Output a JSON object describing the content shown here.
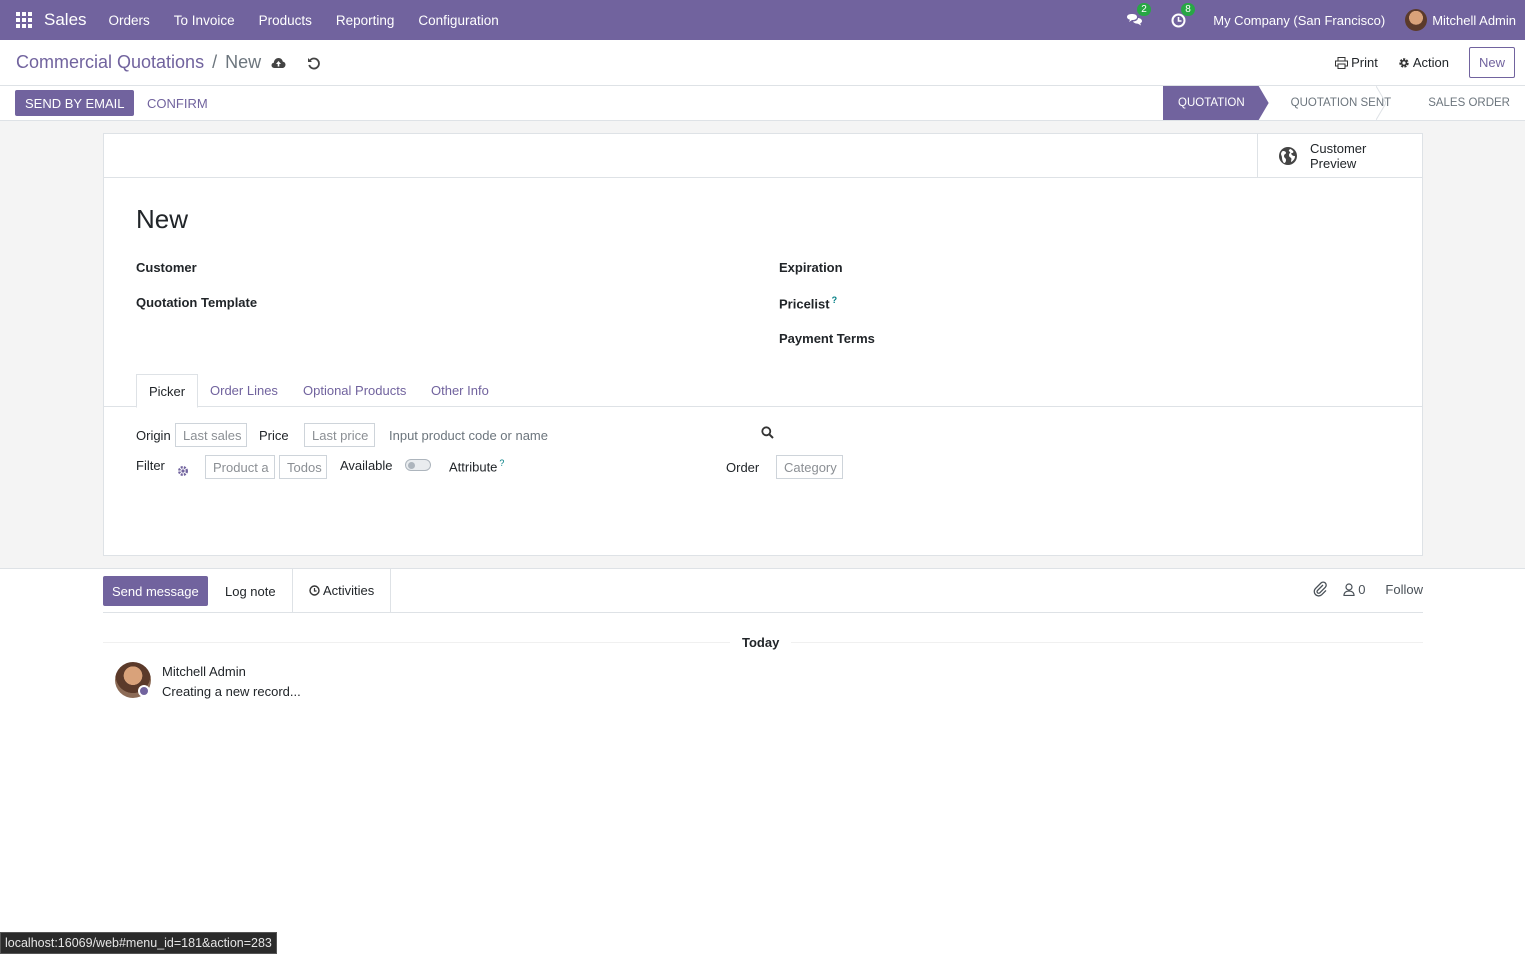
{
  "topbar": {
    "app_name": "Sales",
    "menu": [
      "Orders",
      "To Invoice",
      "Products",
      "Reporting",
      "Configuration"
    ],
    "messages_count": "2",
    "activities_count": "8",
    "company": "My Company (San Francisco)",
    "user": "Mitchell Admin",
    "colors": {
      "brand": "#71639e",
      "badge": "#28a745"
    }
  },
  "control": {
    "breadcrumb_parent": "Commercial Quotations",
    "breadcrumb_current": "New",
    "print_label": "Print",
    "action_label": "Action",
    "new_label": "New",
    "send_email_label": "SEND BY EMAIL",
    "confirm_label": "CONFIRM",
    "stages": [
      "QUOTATION",
      "QUOTATION SENT",
      "SALES ORDER"
    ],
    "active_stage": "QUOTATION"
  },
  "form": {
    "preview_line1": "Customer",
    "preview_line2": "Preview",
    "title": "New",
    "customer_label": "Customer",
    "template_label": "Quotation Template",
    "expiration_label": "Expiration",
    "pricelist_label": "Pricelist",
    "help_mark": "?",
    "payment_terms_label": "Payment Terms",
    "tabs": [
      "Picker",
      "Order Lines",
      "Optional Products",
      "Other Info"
    ],
    "active_tab": "Picker"
  },
  "picker": {
    "origin_label": "Origin",
    "origin_value": "Last sales",
    "price_label": "Price",
    "price_value": "Last price",
    "search_placeholder": "Input product code or name",
    "filter_label": "Filter",
    "filter_product": "Product a",
    "filter_all": "Todos",
    "available_label": "Available",
    "available_on": false,
    "attribute_label": "Attribute",
    "order_label": "Order",
    "order_value": "Category"
  },
  "chatter": {
    "send_message": "Send message",
    "log_note": "Log note",
    "activities": "Activities",
    "followers_count": "0",
    "follow": "Follow",
    "today": "Today",
    "message_author": "Mitchell Admin",
    "message_body": "Creating a new record..."
  },
  "status_url": "localhost:16069/web#menu_id=181&action=283"
}
